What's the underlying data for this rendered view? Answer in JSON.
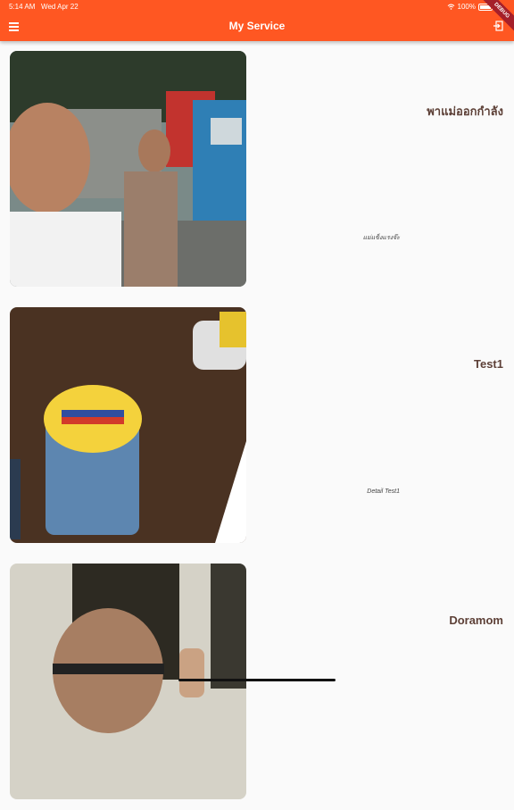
{
  "status_bar": {
    "time": "5:14 AM",
    "date": "Wed Apr 22",
    "battery": "100%"
  },
  "appbar": {
    "title": "My Service",
    "debug_banner": "DEBUG"
  },
  "services": [
    {
      "title": "พาแม่ออกกำลัง",
      "detail": "แม่แข็งแรงจ๊ะ"
    },
    {
      "title": "Test1",
      "detail": "Detail Test1"
    },
    {
      "title": "Doramom",
      "detail": ""
    }
  ],
  "colors": {
    "primary": "#ff5722",
    "title_text": "#5d4037",
    "background": "#fafafa"
  }
}
